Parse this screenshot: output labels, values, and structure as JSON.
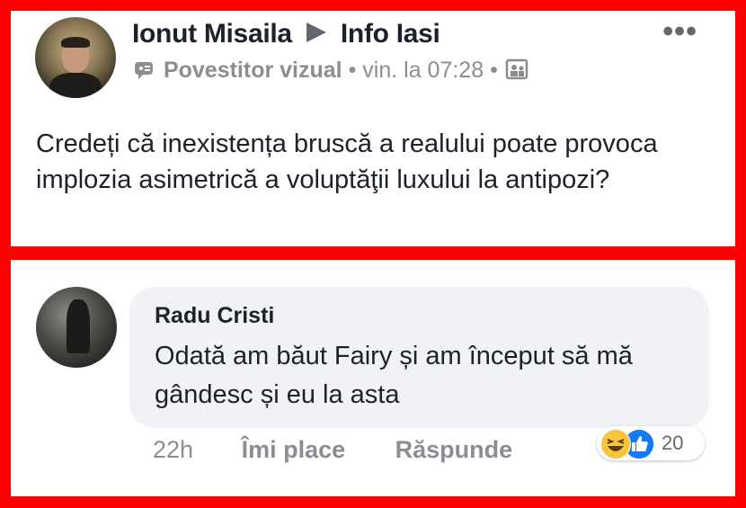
{
  "post": {
    "author_name": "Ionut Misaila",
    "group_name": "Info Iasi",
    "author_badge_icon": "badge-icon",
    "author_badge": "Povestitor vizual",
    "separator": "•",
    "timestamp": "vin. la 07:28",
    "privacy_icon": "group-photo-icon",
    "more_label": "•••",
    "text": "Credeți că inexistența bruscă a realului poate provoca implozia asimetrică a voluptăţii luxului la antipozi?"
  },
  "comment": {
    "author_name": "Radu Cristi",
    "text": "Odată am băut Fairy și am început să mă gândesc și eu la asta",
    "time": "22h",
    "like_label": "Îmi place",
    "reply_label": "Răspunde",
    "reactions": {
      "icons": [
        "haha-icon",
        "like-icon"
      ],
      "count": "20"
    }
  },
  "colors": {
    "frame": "#ff0000",
    "text": "#1d2129",
    "muted": "#8a8d91",
    "bubble": "#f0f2f5",
    "like_blue": "#1877f2",
    "haha_yellow": "#f7c442"
  }
}
